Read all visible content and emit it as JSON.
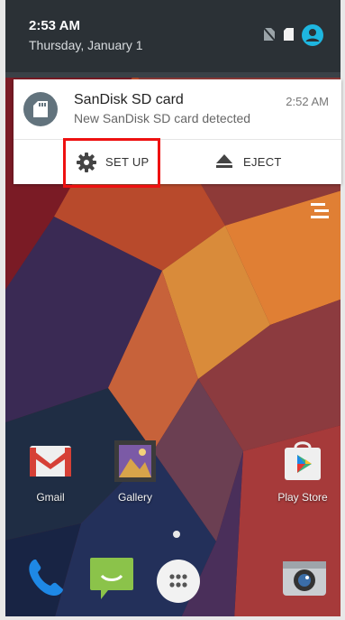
{
  "status_bar": {
    "time": "2:53 AM",
    "date": "Thursday, January 1",
    "icons": [
      "no-sim-icon",
      "sd-card-icon",
      "user-account-icon"
    ]
  },
  "notification": {
    "title": "SanDisk SD card",
    "time": "2:52 AM",
    "text": "New SanDisk SD card detected",
    "icon": "sd-card-icon",
    "actions": {
      "setup": {
        "label": "SET UP",
        "icon": "gear-icon"
      },
      "eject": {
        "label": "EJECT",
        "icon": "eject-icon"
      }
    }
  },
  "highlight_color": "#ee1111",
  "home": {
    "menu_icon": "menu-lines-icon",
    "apps": [
      {
        "label": "Gmail",
        "icon": "gmail-icon"
      },
      {
        "label": "Gallery",
        "icon": "gallery-icon"
      },
      {
        "label": "Play Store",
        "icon": "play-store-icon"
      }
    ],
    "dock": [
      "phone-icon",
      "messaging-icon",
      "app-drawer-icon",
      "camera-icon"
    ]
  }
}
